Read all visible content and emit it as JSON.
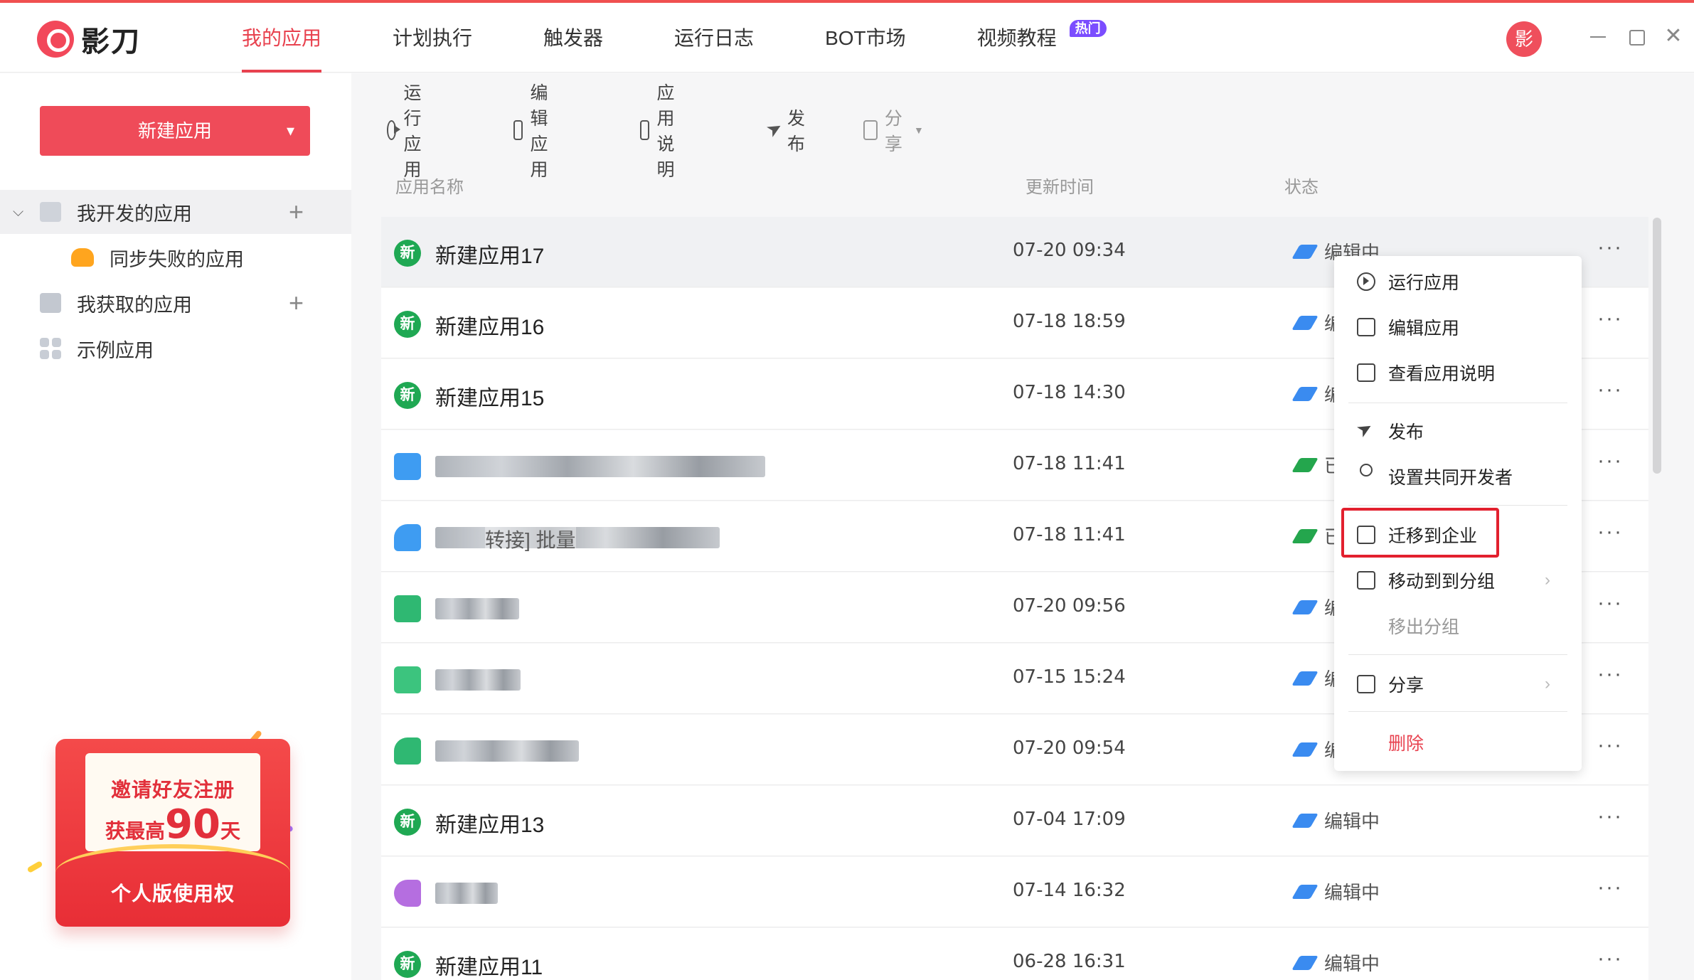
{
  "app": {
    "brand": "影刀",
    "avatar_text": "影"
  },
  "nav": {
    "items": [
      {
        "label": "我的应用"
      },
      {
        "label": "计划执行"
      },
      {
        "label": "触发器"
      },
      {
        "label": "运行日志"
      },
      {
        "label": "BOT市场"
      },
      {
        "label": "视频教程"
      }
    ],
    "hot_badge": "热门"
  },
  "sidebar": {
    "new_app_button": "新建应用",
    "items": [
      {
        "label": "我开发的应用"
      },
      {
        "label": "同步失败的应用"
      },
      {
        "label": "我获取的应用"
      },
      {
        "label": "示例应用"
      }
    ],
    "promo": {
      "line1": "邀请好友注册",
      "line2_prefix": "获最高",
      "line2_number": "90",
      "line2_suffix": "天",
      "line3": "个人版使用权"
    }
  },
  "toolbar": {
    "run": "运行应用",
    "edit": "编辑应用",
    "doc": "应用说明",
    "publish": "发布",
    "share": "分享"
  },
  "table": {
    "headers": {
      "name": "应用名称",
      "time": "更新时间",
      "status": "状态"
    },
    "rows": [
      {
        "icon_text": "新",
        "name": "新建应用17",
        "time": "07-20 09:34",
        "status": "编辑中"
      },
      {
        "icon_text": "新",
        "name": "新建应用16",
        "time": "07-18 18:59",
        "status": "编辑中"
      },
      {
        "icon_text": "新",
        "name": "新建应用15",
        "time": "07-18 14:30",
        "status": "编辑中"
      },
      {
        "icon_text": "",
        "name": "",
        "time": "07-18 11:41",
        "status": "已发布"
      },
      {
        "icon_text": "",
        "name": "转接] 批量",
        "time": "07-18 11:41",
        "status": "已发布"
      },
      {
        "icon_text": "",
        "name": "",
        "time": "07-20 09:56",
        "status": "编辑中"
      },
      {
        "icon_text": "",
        "name": "",
        "time": "07-15 15:24",
        "status": "编辑中"
      },
      {
        "icon_text": "",
        "name": "",
        "time": "07-20 09:54",
        "status": "编辑中"
      },
      {
        "icon_text": "新",
        "name": "新建应用13",
        "time": "07-04 17:09",
        "status": "编辑中"
      },
      {
        "icon_text": "",
        "name": "",
        "time": "07-14 16:32",
        "status": "编辑中"
      },
      {
        "icon_text": "新",
        "name": "新建应用11",
        "time": "06-28 16:31",
        "status": "编辑中"
      }
    ],
    "more_glyph": "···"
  },
  "context_menu": {
    "run": "运行应用",
    "edit": "编辑应用",
    "view_doc": "查看应用说明",
    "publish": "发布",
    "co_dev": "设置共同开发者",
    "migrate": "迁移到企业",
    "move_group": "移动到到分组",
    "remove_group": "移出分组",
    "share": "分享",
    "delete": "删除"
  },
  "colors": {
    "accent": "#e8424f",
    "new_icon": "#1fa853",
    "edit_status": "#3a8bf0",
    "published_status": "#24a64d",
    "highlight": "#e2202e"
  }
}
